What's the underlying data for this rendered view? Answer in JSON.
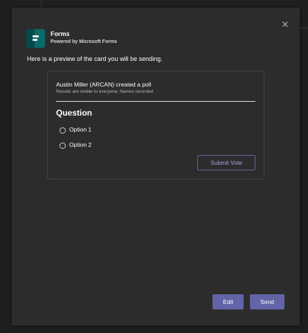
{
  "app": {
    "name": "Forms",
    "subtitle": "Powered by Microsoft Forms"
  },
  "intro_text": "Here is a preview of the card you will be sending.",
  "card": {
    "title": "Austin Miller (ARCAN) created a poll",
    "subtitle": "Results are visible to everyone; Names recorded",
    "question": "Question",
    "options": [
      "Option 1",
      "Option 2"
    ],
    "submit_label": "Submit Vote"
  },
  "footer": {
    "edit_label": "Edit",
    "send_label": "Send"
  },
  "icons": {
    "close": "close-icon",
    "app_logo": "forms-logo-icon",
    "radio": "radio-button"
  },
  "colors": {
    "accent": "#6264a7",
    "dialog_background": "#2d2c2c",
    "page_background": "#201f1f"
  }
}
